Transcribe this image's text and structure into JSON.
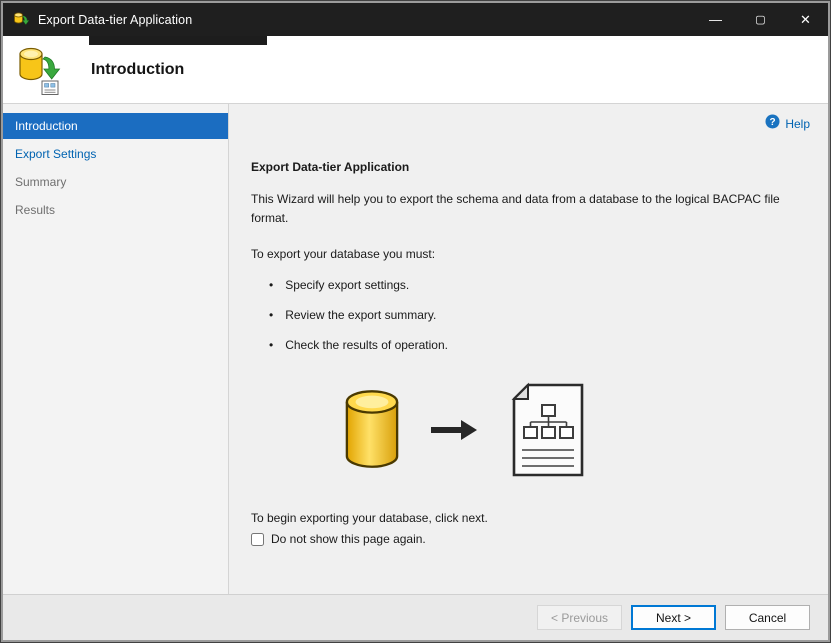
{
  "window": {
    "title": "Export Data-tier Application",
    "minimize_glyph": "—",
    "maximize_glyph": "▢",
    "close_glyph": "✕"
  },
  "header": {
    "title": "Introduction"
  },
  "sidebar": {
    "items": [
      {
        "label": "Introduction",
        "state": "selected"
      },
      {
        "label": "Export Settings",
        "state": "available"
      },
      {
        "label": "Summary",
        "state": "pending"
      },
      {
        "label": "Results",
        "state": "pending"
      }
    ]
  },
  "main": {
    "help_label": "Help",
    "heading": "Export Data-tier Application",
    "intro_text": "This Wizard will help you to export the schema and data from a database to the logical BACPAC file format.",
    "requirements_label": "To export your database you must:",
    "bullets": [
      "Specify export settings.",
      "Review the export summary.",
      "Check the results of operation."
    ],
    "begin_text": "To begin exporting your database, click next.",
    "checkbox": {
      "label": "Do not show this page again.",
      "checked": false
    }
  },
  "footer": {
    "previous_label": "< Previous",
    "previous_enabled": false,
    "next_label": "Next >",
    "cancel_label": "Cancel"
  },
  "icons": {
    "app": "database-export-icon",
    "header": "database-export-icon",
    "help": "help-question-icon",
    "illustration_left": "database-cylinder-icon",
    "illustration_middle": "arrow-right-icon",
    "illustration_right": "bacpac-schema-file-icon"
  },
  "colors": {
    "titlebar_bg": "#1f1f1f",
    "selected_item_bg": "#1b6dc1",
    "link_blue": "#0063b1",
    "accent_blue": "#0078d4",
    "database_yellow": "#f7c518",
    "arrow_green": "#39a83e"
  }
}
